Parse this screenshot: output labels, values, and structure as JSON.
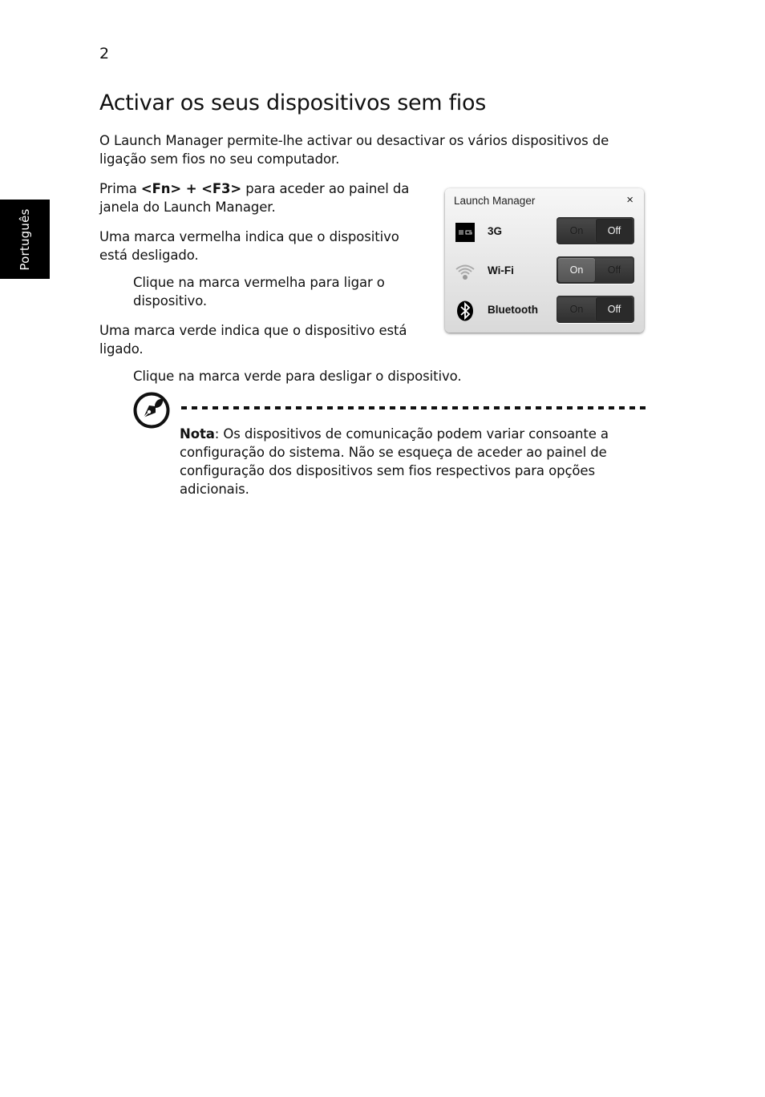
{
  "page_number": "2",
  "side_tab": "Português",
  "title": "Activar os seus dispositivos sem fios",
  "intro": [
    "O Launch Manager permite-lhe activar ou desactivar os vários dispositivos de",
    "ligação sem fios no seu computador."
  ],
  "instructions": {
    "press_prefix": "Prima ",
    "shortcut": "<Fn> + <F3>",
    "press_suffix": " para aceder ao painel da",
    "press_line2": "janela do Launch Manager.",
    "red_line1": "Uma marca vermelha indica que o dispositivo",
    "red_line2": "está desligado.",
    "red_action_line1": "Clique na marca vermelha para ligar o",
    "red_action_line2": "dispositivo.",
    "green_line1": "Uma marca verde indica que o dispositivo está",
    "green_line2": "ligado.",
    "green_action": "Clique na marca verde para desligar o dispositivo."
  },
  "dialog": {
    "title": "Launch Manager",
    "close_glyph": "×",
    "devices": [
      {
        "label": "3G",
        "icon": "3g-icon",
        "on_label": "On",
        "off_label": "Off",
        "state": "off"
      },
      {
        "label": "Wi-Fi",
        "icon": "wifi-icon",
        "on_label": "On",
        "off_label": "Off",
        "state": "on"
      },
      {
        "label": "Bluetooth",
        "icon": "bluetooth-icon",
        "on_label": "On",
        "off_label": "Off",
        "state": "off"
      }
    ]
  },
  "note": {
    "label": "Nota",
    "lines": [
      ": Os dispositivos de comunicação podem variar consoante a",
      "configuração do sistema. Não se esqueça de aceder ao painel de",
      "configuração dos dispositivos sem fios respectivos para opções",
      "adicionais."
    ]
  }
}
